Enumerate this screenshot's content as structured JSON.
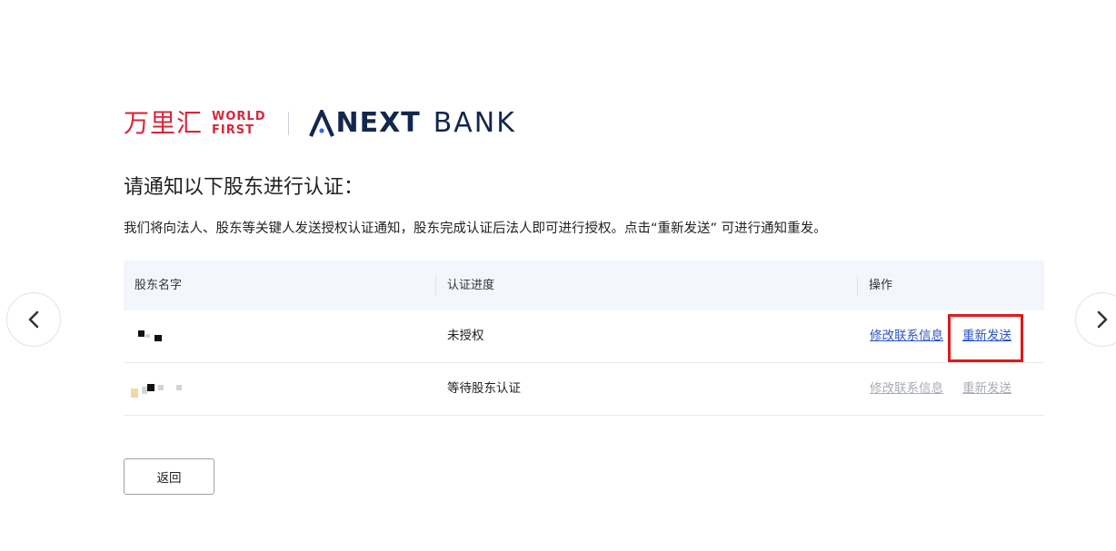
{
  "brand": {
    "worldfirst_cn": "万里汇",
    "worldfirst_en_line1": "WORLD",
    "worldfirst_en_line2": "FIRST",
    "anext": "NEXT",
    "bank": "BANK",
    "brand_red": "#d9263b",
    "brand_navy": "#13274e"
  },
  "header": {
    "title": "请通知以下股东进行认证：",
    "description": "我们将向法人、股东等关键人发送授权认证通知，股东完成认证后法人即可进行授权。点击“重新发送” 可进行通知重发。"
  },
  "table": {
    "columns": [
      "股东名字",
      "认证进度",
      "操作"
    ],
    "rows": [
      {
        "name": "",
        "status": "未授权",
        "action_edit": "修改联系信息",
        "action_resend": "重新发送",
        "actions_enabled": true
      },
      {
        "name": "",
        "status": "等待股东认证",
        "action_edit": "修改联系信息",
        "action_resend": "重新发送",
        "actions_enabled": false
      }
    ],
    "link_color": "#2b55c4",
    "disabled_color": "#a8adb5"
  },
  "footer": {
    "back_label": "返回"
  },
  "nav": {
    "prev_icon": "chevron-left-icon",
    "next_icon": "chevron-right-icon"
  }
}
